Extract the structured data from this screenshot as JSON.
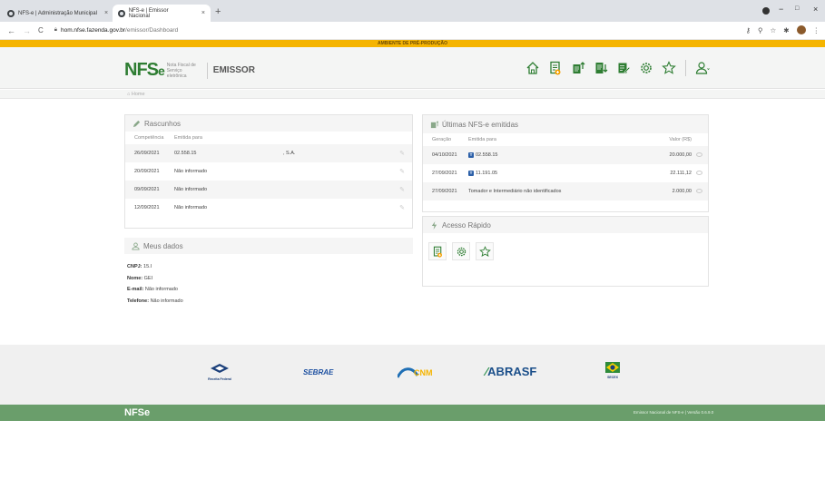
{
  "browser": {
    "tabs": [
      {
        "title": "NFS-e | Administração Municipal",
        "close": "×"
      },
      {
        "title": "NFS-e | Emissor Nacional",
        "close": "×"
      }
    ],
    "new_tab": "+",
    "window_controls": [
      "−",
      "□",
      "×"
    ],
    "url_host": "hom.nfse.fazenda.gov.br",
    "url_path": "/emissor/Dashboard",
    "nav": [
      "←",
      "→",
      "C"
    ]
  },
  "env_banner": "AMBIENTE DE PRÉ-PRODUÇÃO",
  "header": {
    "logo_main": "NFS",
    "logo_e": "e",
    "logo_sub": "Nota Fiscal de Serviço eletrônica",
    "app_name": "EMISSOR"
  },
  "breadcrumb": "Home",
  "rascunhos": {
    "title": "Rascunhos",
    "columns": [
      "Competência",
      "Emitida para"
    ],
    "rows": [
      {
        "date": "26/09/2021",
        "to": "02.558.15",
        "extra": ", S.A."
      },
      {
        "date": "20/09/2021",
        "to": "Não informado",
        "extra": ""
      },
      {
        "date": "09/09/2021",
        "to": "Não informado",
        "extra": ""
      },
      {
        "date": "12/09/2021",
        "to": "Não informado",
        "extra": ""
      }
    ]
  },
  "meus_dados": {
    "title": "Meus dados",
    "cnpj_label": "CNPJ:",
    "cnpj": "15.I",
    "nome_label": "Nome:",
    "nome": "GEI",
    "email_label": "E-mail:",
    "email": "Não informado",
    "tel_label": "Telefone:",
    "tel": "Não informado"
  },
  "ultimas": {
    "title": "Últimas NFS-e emitidas",
    "columns": [
      "Geração",
      "Emitida para",
      "Valor (R$)"
    ],
    "rows": [
      {
        "date": "04/10/2021",
        "badge": "T",
        "to": "02.558.15",
        "value": "20.000,00"
      },
      {
        "date": "27/09/2021",
        "badge": "T",
        "to": "11.191.05",
        "value": "22.111,12"
      },
      {
        "date": "27/09/2021",
        "badge": "",
        "to": "Tomador e Intermediário não identificados",
        "value": "2.000,00"
      }
    ]
  },
  "acesso": {
    "title": "Acesso Rápido"
  },
  "partners": [
    "Receita Federal",
    "SEBRAE",
    "CNM",
    "ABRASF",
    "SECEX"
  ],
  "footer": {
    "logo": "NFSe",
    "version": "Emissor Nacional de NFS-e | Versão 0.6.9.0"
  },
  "colors": {
    "green": "#2e7d32",
    "footer": "#6a9e6b",
    "banner": "#f5b400"
  }
}
